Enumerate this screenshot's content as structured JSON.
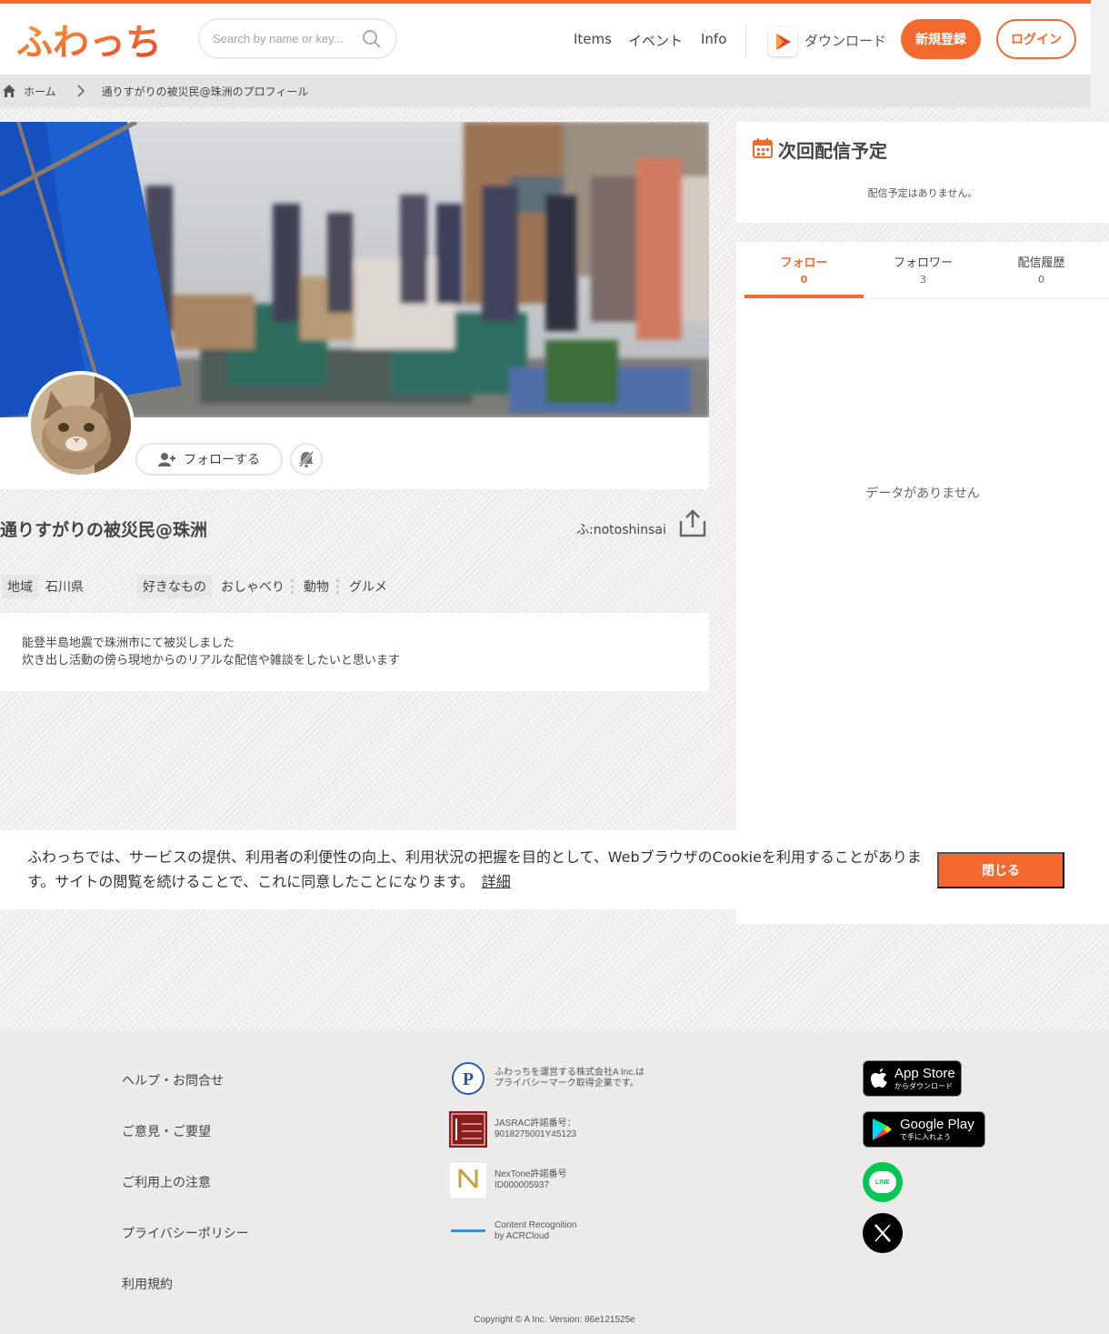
{
  "header": {
    "logo_text": "ふわっち",
    "search_placeholder": "Search by name or key...",
    "nav": [
      "Items",
      "イベント",
      "Info"
    ],
    "download_label": "ダウンロード",
    "signup_label": "新規登録",
    "login_label": "ログイン"
  },
  "breadcrumb": {
    "home": "ホーム",
    "current": "通りすがりの被災民@珠洲のプロフィール"
  },
  "profile": {
    "follow_label": "フォローする",
    "name": "通りすがりの被災民@珠洲",
    "user_id": "ふ:notoshinsai",
    "region_label": "地域",
    "region_value": "石川県",
    "likes_label": "好きなもの",
    "likes": [
      "おしゃべり",
      "動物",
      "グルメ"
    ],
    "bio_lines": [
      "能登半島地震で珠洲市にて被災しました",
      "炊き出し活動の傍ら現地からのリアルな配信や雑談をしたいと思います"
    ]
  },
  "schedule": {
    "title": "次回配信予定",
    "empty": "配信予定はありません。"
  },
  "tabs": [
    {
      "label": "フォロー",
      "count": "0"
    },
    {
      "label": "フォロワー",
      "count": "3"
    },
    {
      "label": "配信履歴",
      "count": "0"
    }
  ],
  "no_data": "データがありません",
  "cookie": {
    "text": "ふわっちでは、サービスの提供、利用者の利便性の向上、利用状況の把握を目的として、WebブラウザのCookieを利用することがあります。サイトの閲覧を続けることで、これに同意したことになります。",
    "link": "詳細",
    "close_label": "閉じる"
  },
  "footer": {
    "links": [
      "ヘルプ・お問合せ",
      "ご意見・ご要望",
      "ご利用上の注意",
      "プライバシーポリシー",
      "利用規約"
    ],
    "certs": [
      {
        "line1": "ふわっちを運営する株式会社A Inc.は",
        "line2": "プライバシーマーク取得企業です。"
      },
      {
        "line1": "JASRAC許諾番号：",
        "line2": "9018275001Y45123"
      },
      {
        "line1": "NexTone許諾番号",
        "line2": "ID000005937"
      },
      {
        "line1": "Content Recognition",
        "line2": "by ACRCloud"
      }
    ],
    "app_store": {
      "big": "App Store",
      "small": "からダウンロード"
    },
    "google_play": {
      "big": "Google Play",
      "small": "で手に入れよう"
    },
    "line_label": "LINE",
    "copyright": "Copyright © A Inc. Version: 86e121525e"
  },
  "colors": {
    "accent": "#f4692d",
    "line_green": "#06c755"
  }
}
